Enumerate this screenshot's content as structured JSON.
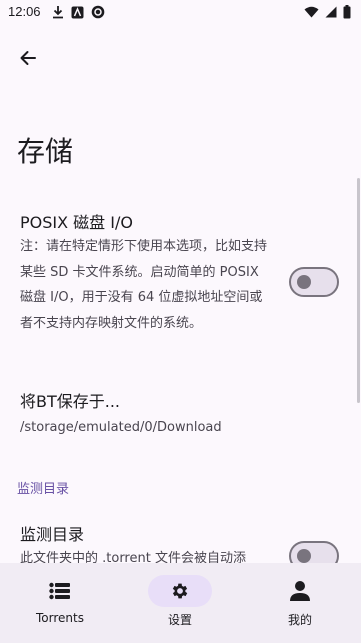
{
  "status_bar": {
    "time": "12:06"
  },
  "header": {
    "back_icon": "arrow-back-icon"
  },
  "page": {
    "title": "存储"
  },
  "settings": {
    "posix": {
      "title": "POSIX 磁盘 I/O",
      "description": "注：请在特定情形下使用本选项，比如支持某些 SD 卡文件系统。启动简单的 POSIX 磁盘 I/O，用于没有 64 位虚拟地址空间或者不支持内存映射文件的系统。",
      "enabled": false
    },
    "save_location": {
      "title": "将BT保存于...",
      "value": "/storage/emulated/0/Download"
    },
    "watch_section": {
      "header": "监测目录"
    },
    "watch_dir": {
      "title": "监测目录",
      "description": "此文件夹中的 .torrent 文件会被自动添",
      "enabled": false
    }
  },
  "bottom_nav": {
    "items": [
      {
        "label": "Torrents",
        "icon": "list-icon",
        "selected": false
      },
      {
        "label": "设置",
        "icon": "gear-icon",
        "selected": true
      },
      {
        "label": "我的",
        "icon": "person-icon",
        "selected": false
      }
    ]
  },
  "colors": {
    "accent": "#6750a4",
    "background": "#fcf8fd",
    "nav_background": "#f1ecf4",
    "pill": "#e8def8"
  }
}
